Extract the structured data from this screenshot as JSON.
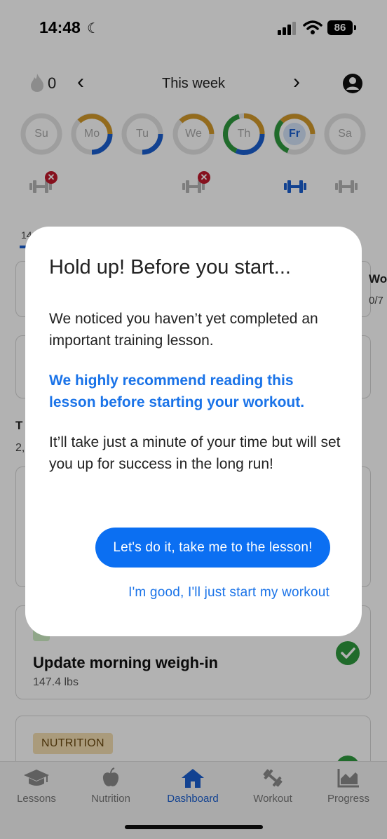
{
  "status_bar": {
    "time": "14:48",
    "battery": "86"
  },
  "week_header": {
    "streak": "0",
    "title": "This week"
  },
  "days": [
    {
      "label": "Su",
      "progress": []
    },
    {
      "label": "Mo",
      "progress": [
        "gold",
        "blue"
      ]
    },
    {
      "label": "Tu",
      "progress": [
        "blue"
      ]
    },
    {
      "label": "We",
      "progress": [
        "gold"
      ]
    },
    {
      "label": "Th",
      "progress": [
        "gold",
        "blue",
        "green"
      ]
    },
    {
      "label": "Fr",
      "progress": [
        "gold",
        "green"
      ],
      "today": true
    },
    {
      "label": "Sa",
      "progress": []
    }
  ],
  "background": {
    "tab_fragment": "14",
    "card_fragment_a": "Wo",
    "card_fragment_b": "0/7",
    "section_fragment_a": "T",
    "section_fragment_b": "2,"
  },
  "task_card": {
    "title": "Update morning weigh-in",
    "subtitle": "147.4 lbs"
  },
  "nutrition_card": {
    "badge": "NUTRITION"
  },
  "bottom_nav": {
    "items": [
      {
        "label": "Lessons",
        "icon": "graduation-cap-icon"
      },
      {
        "label": "Nutrition",
        "icon": "apple-icon"
      },
      {
        "label": "Dashboard",
        "icon": "home-icon",
        "active": true
      },
      {
        "label": "Workout",
        "icon": "dumbbell-icon"
      },
      {
        "label": "Progress",
        "icon": "chart-icon"
      }
    ]
  },
  "modal": {
    "title": "Hold up! Before you start...",
    "paragraph_1": "We noticed you haven’t yet completed an important training lesson.",
    "paragraph_2": "We highly recommend reading this lesson before starting your workout.",
    "paragraph_3": "It’ll take just a minute of your time but will set you up for success in the long run!",
    "primary_button": "Let's do it, take me to the lesson!",
    "secondary_link": "I'm good, I'll just start my workout"
  },
  "colors": {
    "accent_blue": "#0b6ff2",
    "ring_blue": "#1a5fd0",
    "ring_gold": "#d39a2a",
    "ring_green": "#2e9a3e",
    "overlay": "rgba(0,0,0,0.30)"
  }
}
